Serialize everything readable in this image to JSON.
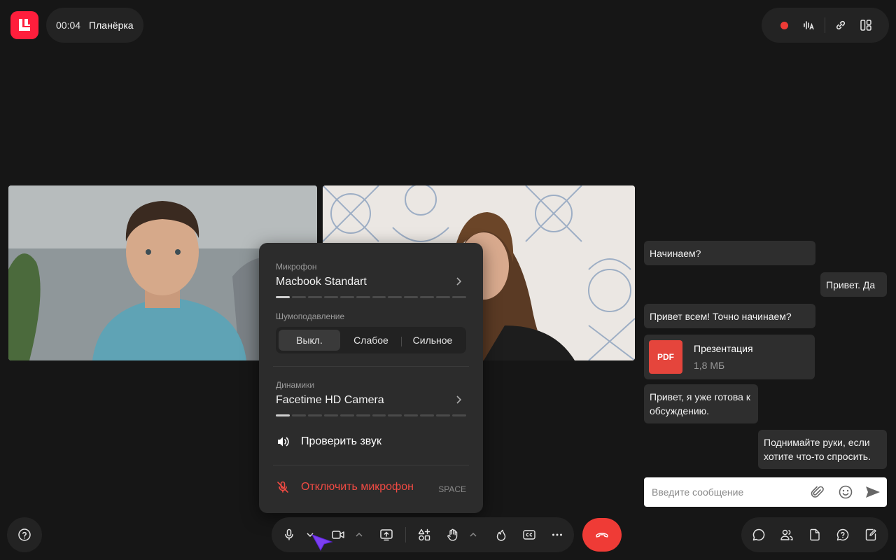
{
  "header": {
    "timer": "00:04",
    "title": "Планёрка"
  },
  "colors": {
    "brand": "#ff1e3c",
    "danger": "#ef3b36",
    "panel": "#232323",
    "popup": "#2c2c2c"
  },
  "top_controls": [
    {
      "name": "record-indicator"
    },
    {
      "name": "transcription-icon"
    },
    {
      "name": "link-icon"
    },
    {
      "name": "layout-icon"
    }
  ],
  "audio_popup": {
    "mic_label": "Микрофон",
    "mic_value": "Macbook Standart",
    "mic_level": 0.08,
    "noise_label": "Шумоподавление",
    "noise_options": [
      "Выкл.",
      "Слабое",
      "Сильное"
    ],
    "noise_selected": "Выкл.",
    "speakers_label": "Динамики",
    "speakers_value": "Facetime HD Camera",
    "speakers_level": 0.08,
    "test_sound": "Проверить звук",
    "mute_mic": "Отключить микрофон",
    "mute_shortcut": "SPACE"
  },
  "chat": {
    "messages": [
      {
        "text": "Начинаем?"
      },
      {
        "text": "Привет. Да"
      },
      {
        "text": "Привет всем! Точно начинаем?"
      },
      {
        "text": "Привет, я уже готова к обсуждению."
      },
      {
        "text": "Поднимайте руки, если хотите что-то спросить."
      }
    ],
    "file": {
      "type": "PDF",
      "name": "Презентация",
      "size": "1,8 МБ"
    },
    "input_placeholder": "Введите сообщение"
  },
  "toolbar": {
    "buttons": [
      "microphone-icon",
      "camera-icon",
      "share-screen-icon",
      "apps-icon",
      "raise-hand-icon",
      "reaction-icon",
      "captions-icon",
      "more-icon",
      "end-call-icon"
    ]
  },
  "right_controls": [
    "chat-icon",
    "participants-icon",
    "files-icon",
    "questions-icon",
    "notes-icon"
  ]
}
